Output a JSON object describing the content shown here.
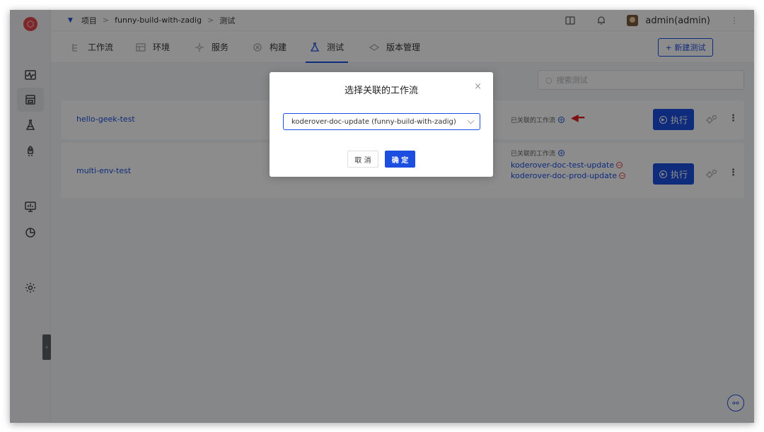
{
  "topbar": {
    "breadcrumb": [
      "项目",
      "funny-build-with-zadig",
      "测试"
    ],
    "separator": ">",
    "username": "admin(admin)"
  },
  "tabs": [
    {
      "label": "工作流",
      "icon": "workflow-icon"
    },
    {
      "label": "环境",
      "icon": "environment-icon"
    },
    {
      "label": "服务",
      "icon": "service-icon"
    },
    {
      "label": "构建",
      "icon": "build-icon"
    },
    {
      "label": "测试",
      "icon": "flask-icon",
      "active": true
    },
    {
      "label": "版本管理",
      "icon": "version-icon"
    }
  ],
  "new_test_button": "+ 新建测试",
  "search_placeholder": "搜索测试",
  "tests": [
    {
      "name": "hello-geek-test",
      "workflow_label": "已关联的工作流",
      "workflows": [],
      "run_label": "执行"
    },
    {
      "name": "multi-env-test",
      "workflow_label": "已关联的工作流",
      "workflows": [
        "koderover-doc-test-update",
        "koderover-doc-prod-update"
      ],
      "run_label": "执行"
    }
  ],
  "modal": {
    "title": "选择关联的工作流",
    "close": "×",
    "selected_workflow": "koderover-doc-update (funny-build-with-zadig)",
    "cancel_label": "取 消",
    "confirm_label": "确 定"
  },
  "colors": {
    "primary": "#1c4fe0",
    "danger": "#e5484d",
    "arrow": "#e02020"
  }
}
